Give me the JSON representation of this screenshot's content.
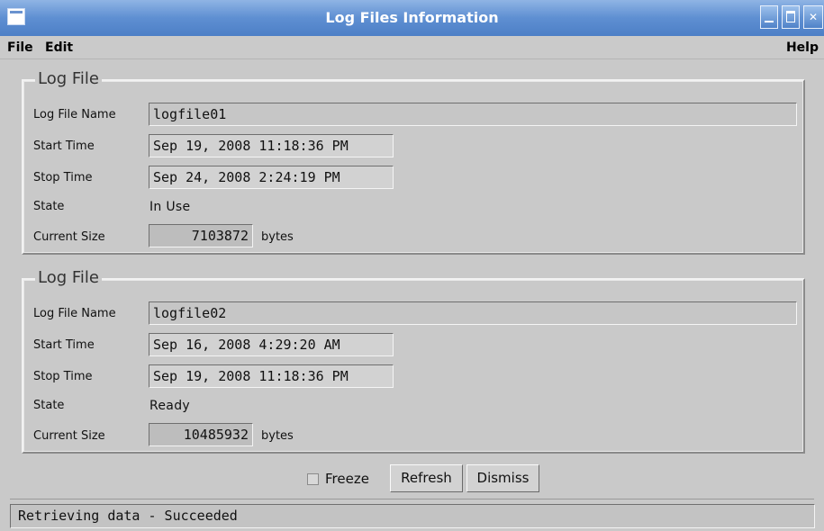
{
  "window": {
    "title": "Log Files Information"
  },
  "menu": {
    "file": "File",
    "edit": "Edit",
    "help": "Help"
  },
  "log_files": [
    {
      "legend": "Log File",
      "labels": {
        "name": "Log File Name",
        "start": "Start Time",
        "stop": "Stop Time",
        "state": "State",
        "size": "Current Size"
      },
      "name": "logfile01",
      "start": "Sep 19, 2008 11:18:36 PM",
      "stop": "Sep 24, 2008 2:24:19 PM",
      "state": "In Use",
      "size": "7103872",
      "size_unit": "bytes"
    },
    {
      "legend": "Log File",
      "labels": {
        "name": "Log File Name",
        "start": "Start Time",
        "stop": "Stop Time",
        "state": "State",
        "size": "Current Size"
      },
      "name": "logfile02",
      "start": "Sep 16, 2008 4:29:20 AM",
      "stop": "Sep 19, 2008 11:18:36 PM",
      "state": "Ready",
      "size": "10485932",
      "size_unit": "bytes"
    }
  ],
  "controls": {
    "freeze_label": "Freeze",
    "freeze_checked": false,
    "refresh_label": "Refresh",
    "dismiss_label": "Dismiss"
  },
  "status": {
    "text": "Retrieving data - Succeeded"
  }
}
